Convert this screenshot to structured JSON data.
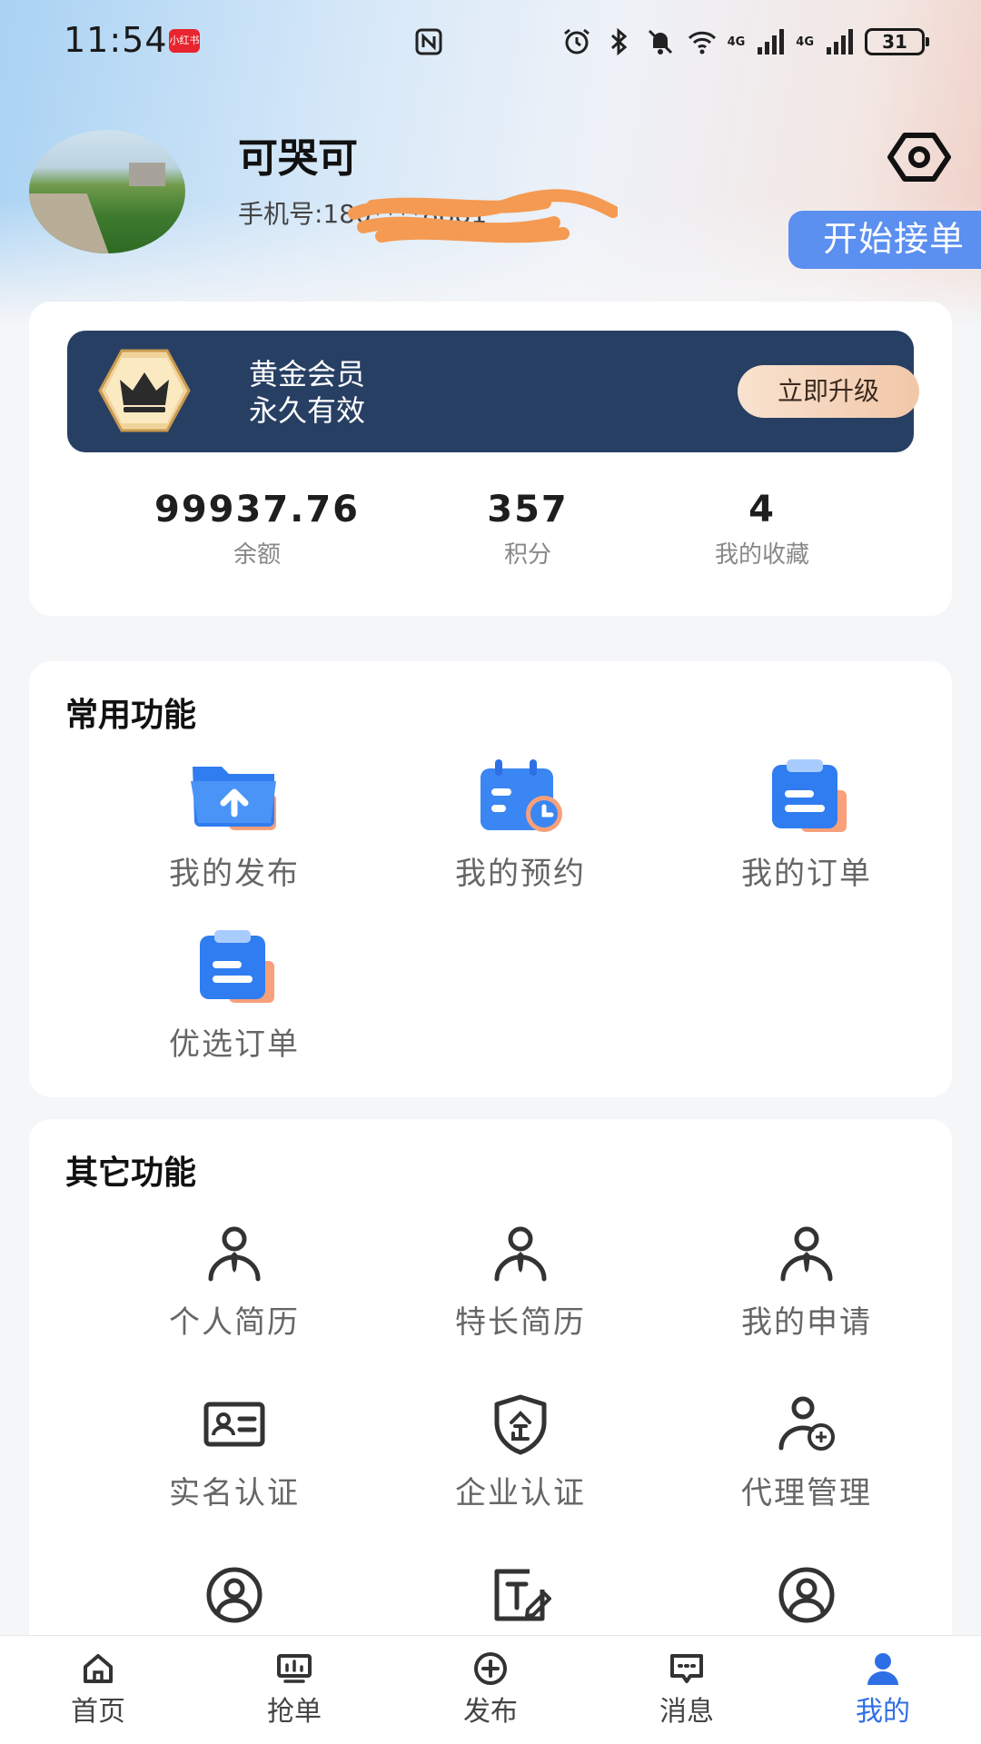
{
  "status_bar": {
    "time": "11:54",
    "app_badge": "小红书",
    "network_1": "4G",
    "network_2": "4G",
    "battery": "31"
  },
  "profile": {
    "name": "可哭可",
    "phone": "手机号:180****8881"
  },
  "actions": {
    "start_order": "开始接单"
  },
  "membership": {
    "title": "黄金会员",
    "validity": "永久有效",
    "upgrade": "立即升级"
  },
  "stats": [
    {
      "value": "99937.76",
      "label": "余额"
    },
    {
      "value": "357",
      "label": "积分"
    },
    {
      "value": "4",
      "label": "我的收藏"
    }
  ],
  "common_functions": {
    "title": "常用功能",
    "items": [
      {
        "label": "我的发布",
        "icon": "folder-upload-icon"
      },
      {
        "label": "我的预约",
        "icon": "calendar-clock-icon"
      },
      {
        "label": "我的订单",
        "icon": "clipboard-icon"
      },
      {
        "label": "优选订单",
        "icon": "clipboard-icon"
      }
    ]
  },
  "other_functions": {
    "title": "其它功能",
    "items": [
      {
        "label": "个人简历",
        "icon": "person-tie-icon"
      },
      {
        "label": "特长简历",
        "icon": "person-tie-icon"
      },
      {
        "label": "我的申请",
        "icon": "person-tie-icon"
      },
      {
        "label": "实名认证",
        "icon": "id-card-icon"
      },
      {
        "label": "企业认证",
        "icon": "shield-enterprise-icon"
      },
      {
        "label": "代理管理",
        "icon": "agent-person-icon"
      },
      {
        "label": "",
        "icon": "user-circle-icon"
      },
      {
        "label": "",
        "icon": "text-edit-icon"
      },
      {
        "label": "",
        "icon": "user-circle-icon"
      }
    ]
  },
  "bottom_nav": [
    {
      "label": "首页",
      "icon": "home-icon"
    },
    {
      "label": "抢单",
      "icon": "monitor-icon"
    },
    {
      "label": "发布",
      "icon": "plus-circle-icon"
    },
    {
      "label": "消息",
      "icon": "message-icon"
    },
    {
      "label": "我的",
      "icon": "user-icon",
      "active": true
    }
  ],
  "colors": {
    "accent": "#2f6fe6",
    "start_button": "#5b8ff0",
    "vip_banner": "#273f63"
  }
}
